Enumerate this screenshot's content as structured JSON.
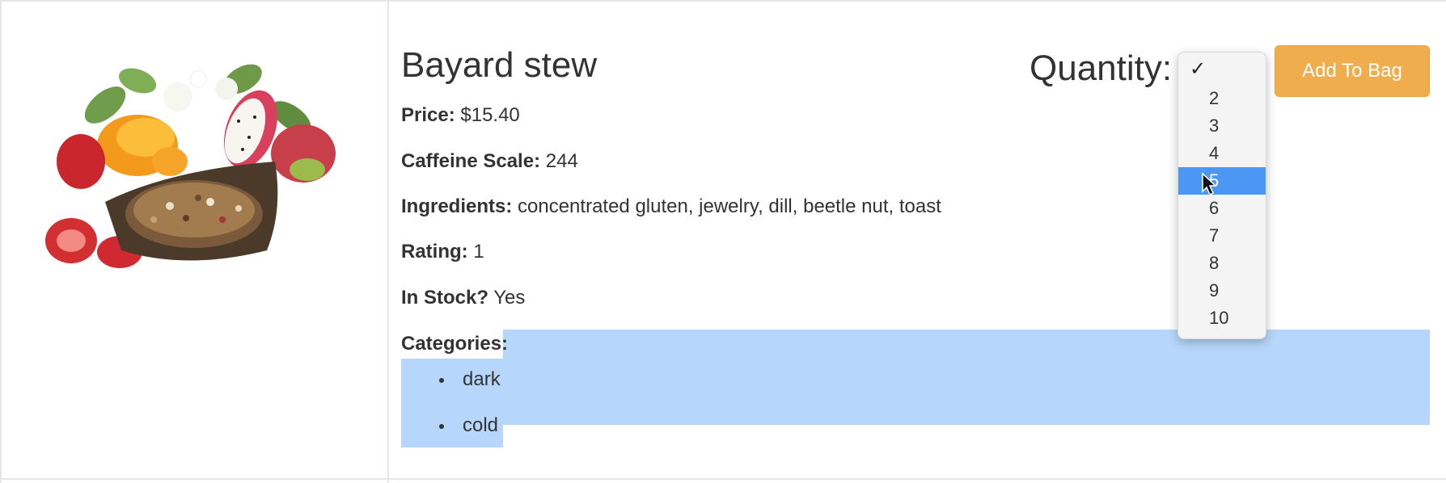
{
  "product": {
    "name": "Bayard stew",
    "price_label": "Price:",
    "price": "$15.40",
    "caffeine_label": "Caffeine Scale:",
    "caffeine": "244",
    "ingredients_label": "Ingredients:",
    "ingredients": "concentrated gluten, jewelry, dill, beetle nut, toast",
    "rating_label": "Rating:",
    "rating": "1",
    "stock_label": "In Stock?",
    "stock": "Yes",
    "categories_label": "Categories:",
    "categories": [
      "dark",
      "cold"
    ]
  },
  "quantity": {
    "label": "Quantity:",
    "options": [
      "",
      "2",
      "3",
      "4",
      "5",
      "6",
      "7",
      "8",
      "9",
      "10"
    ],
    "checked_index": 0,
    "highlighted": "5"
  },
  "add_button": {
    "label": "Add To Bag"
  },
  "colors": {
    "button": "#f0ad4e",
    "selection": "#b6d7fb",
    "highlight": "#4a97f4"
  }
}
